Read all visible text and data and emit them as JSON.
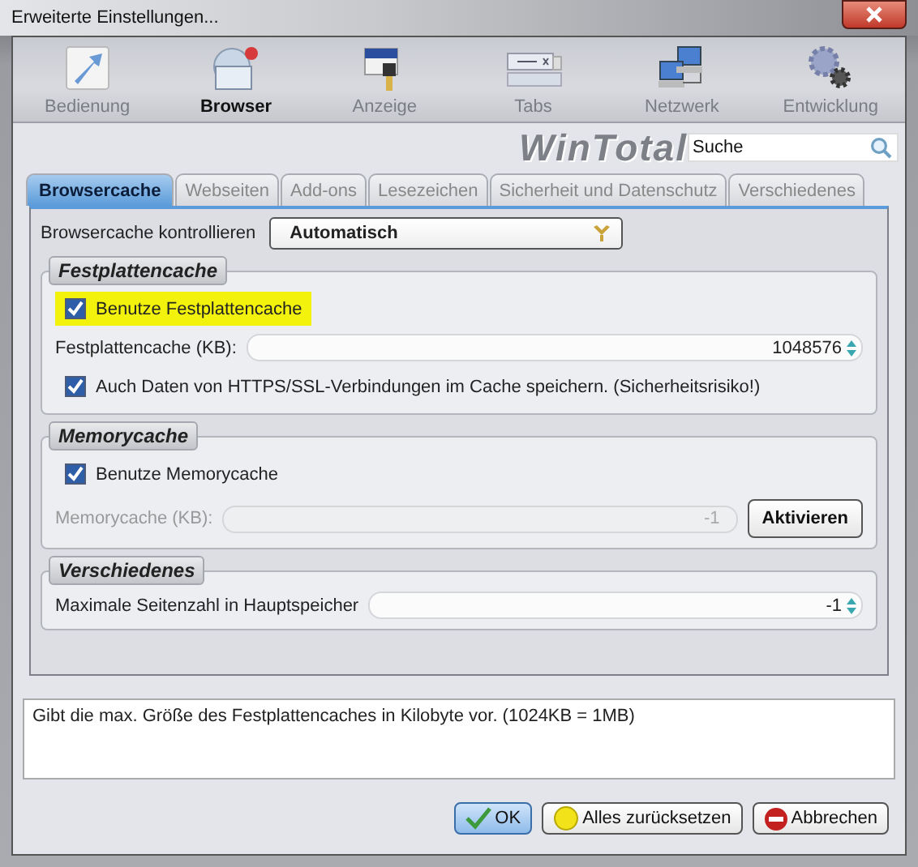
{
  "window": {
    "title": "Erweiterte Einstellungen..."
  },
  "toolbar": [
    {
      "label": "Bedienung",
      "kind": "pointer",
      "selected": false
    },
    {
      "label": "Browser",
      "kind": "browser",
      "selected": true
    },
    {
      "label": "Anzeige",
      "kind": "brush",
      "selected": false
    },
    {
      "label": "Tabs",
      "kind": "tabs",
      "selected": false
    },
    {
      "label": "Netzwerk",
      "kind": "network",
      "selected": false
    },
    {
      "label": "Entwicklung",
      "kind": "gears",
      "selected": false
    }
  ],
  "logo": "WinTotal",
  "search": {
    "value": "Suche"
  },
  "tabs": [
    {
      "label": "Browsercache",
      "selected": true
    },
    {
      "label": "Webseiten",
      "selected": false
    },
    {
      "label": "Add-ons",
      "selected": false
    },
    {
      "label": "Lesezeichen",
      "selected": false
    },
    {
      "label": "Sicherheit und Datenschutz",
      "selected": false
    },
    {
      "label": "Verschiedenes",
      "selected": false
    }
  ],
  "cache_control": {
    "label": "Browsercache kontrollieren",
    "value": "Automatisch"
  },
  "groups": [
    {
      "title": "Festplattencache",
      "rows": [
        {
          "kind": "checkbox",
          "label": "Benutze Festplattencache",
          "checked": true,
          "highlighted": true
        },
        {
          "kind": "spin",
          "label": "Festplattencache (KB):",
          "value": "1048576",
          "disabled": false
        },
        {
          "kind": "checkbox",
          "label": "Auch Daten von HTTPS/SSL-Verbindungen im Cache speichern. (Sicherheitsrisiko!)",
          "checked": true,
          "highlighted": false
        }
      ]
    },
    {
      "title": "Memorycache",
      "rows": [
        {
          "kind": "checkbox",
          "label": "Benutze Memorycache",
          "checked": true,
          "highlighted": false
        },
        {
          "kind": "spin",
          "label": "Memorycache (KB):",
          "value": "-1",
          "disabled": true,
          "button": "Aktivieren"
        }
      ]
    },
    {
      "title": "Verschiedenes",
      "rows": [
        {
          "kind": "spin",
          "label": "Maximale Seitenzahl in Hauptspeicher",
          "value": "-1",
          "disabled": false
        }
      ]
    }
  ],
  "description": "Gibt die max. Größe des Festplattencaches in Kilobyte vor. (1024KB = 1MB)",
  "buttons": [
    {
      "label": "OK",
      "kind": "ok",
      "default": true
    },
    {
      "label": "Alles zurücksetzen",
      "kind": "reset",
      "default": false
    },
    {
      "label": "Abbrechen",
      "kind": "cancel",
      "default": false
    }
  ]
}
